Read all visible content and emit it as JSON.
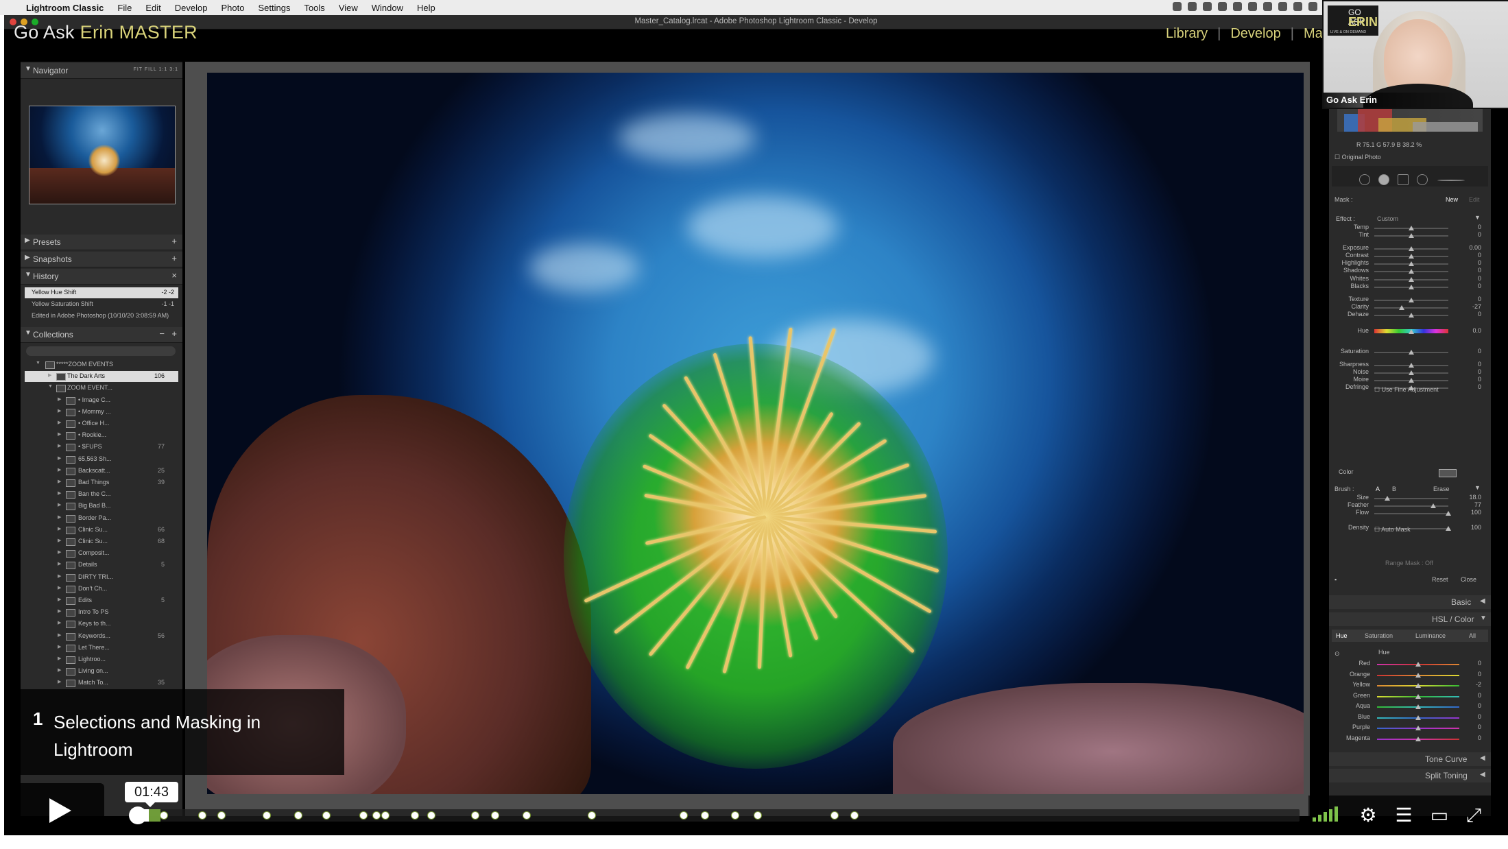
{
  "menubar": {
    "app": "Lightroom Classic",
    "items": [
      "File",
      "Edit",
      "Develop",
      "Photo",
      "Settings",
      "Tools",
      "View",
      "Window",
      "Help"
    ]
  },
  "window": {
    "title": "Master_Catalog.lrcat - Adobe Photoshop Lightroom Classic - Develop"
  },
  "identity_plate": {
    "part1": "Go Ask ",
    "part2": "Erin MASTER"
  },
  "modules": {
    "library": "Library",
    "develop": "Develop",
    "map": "Map"
  },
  "left": {
    "navigator": {
      "label": "Navigator",
      "zoom": "FIT  FILL  1:1  3:1"
    },
    "presets": "Presets",
    "snapshots": "Snapshots",
    "history": {
      "label": "History",
      "rows": [
        {
          "text": "Yellow Hue Shift",
          "a": "-2",
          "b": "-2"
        },
        {
          "text": "Yellow Saturation Shift",
          "a": "-1",
          "b": "-1"
        },
        {
          "text": "Edited in Adobe Photoshop (10/10/20 3:08:59 AM)",
          "a": "",
          "b": ""
        }
      ]
    },
    "collections": {
      "label": "Collections",
      "rows": [
        {
          "text": "*****ZOOM EVENTS",
          "n": ""
        },
        {
          "text": "The Dark Arts",
          "n": "106"
        },
        {
          "text": "ZOOM EVENT...",
          "n": ""
        },
        {
          "text": "• Image C...",
          "n": ""
        },
        {
          "text": "• Mommy ...",
          "n": ""
        },
        {
          "text": "• Office H...",
          "n": ""
        },
        {
          "text": "• Rookie...",
          "n": ""
        },
        {
          "text": "• $FUPS",
          "n": "77"
        },
        {
          "text": "65,563 Sh...",
          "n": ""
        },
        {
          "text": "Backscatt...",
          "n": "25"
        },
        {
          "text": "Bad Things",
          "n": "39"
        },
        {
          "text": "Ban the C...",
          "n": ""
        },
        {
          "text": "Big Bad B...",
          "n": ""
        },
        {
          "text": "Border Pa...",
          "n": ""
        },
        {
          "text": "Clinic Su...",
          "n": "66"
        },
        {
          "text": "Clinic Su...",
          "n": "68"
        },
        {
          "text": "Composit...",
          "n": ""
        },
        {
          "text": "Details",
          "n": "5"
        },
        {
          "text": "DIRTY TRI...",
          "n": ""
        },
        {
          "text": "Don't Ch...",
          "n": ""
        },
        {
          "text": "Edits",
          "n": "5"
        },
        {
          "text": "Intro To PS",
          "n": ""
        },
        {
          "text": "Keys to th...",
          "n": ""
        },
        {
          "text": "Keywords...",
          "n": "56"
        },
        {
          "text": "Let There...",
          "n": ""
        },
        {
          "text": "Lightroo...",
          "n": ""
        },
        {
          "text": "Living on...",
          "n": ""
        },
        {
          "text": "Match To...",
          "n": "35"
        }
      ]
    }
  },
  "right": {
    "readout": {
      "r_label": "R",
      "r": "75.1",
      "g_label": "G",
      "g": "57.9",
      "b_label": "B",
      "b": "38.2",
      "unit": "%"
    },
    "original_photo": "Original Photo",
    "mask": {
      "label": "Mask :",
      "new": "New",
      "edit": "Edit"
    },
    "effect": {
      "label": "Effect :",
      "value": "Custom"
    },
    "sliders": [
      {
        "label": "Temp",
        "value": "0"
      },
      {
        "label": "Tint",
        "value": "0"
      },
      {
        "label": "Exposure",
        "value": "0.00"
      },
      {
        "label": "Contrast",
        "value": "0"
      },
      {
        "label": "Highlights",
        "value": "0"
      },
      {
        "label": "Shadows",
        "value": "0"
      },
      {
        "label": "Whites",
        "value": "0"
      },
      {
        "label": "Blacks",
        "value": "0"
      },
      {
        "label": "Texture",
        "value": "0"
      },
      {
        "label": "Clarity",
        "value": "-27"
      },
      {
        "label": "Dehaze",
        "value": "0"
      },
      {
        "label": "Hue",
        "value": "0.0"
      },
      {
        "label": "Saturation",
        "value": "0"
      },
      {
        "label": "Sharpness",
        "value": "0"
      },
      {
        "label": "Noise",
        "value": "0"
      },
      {
        "label": "Moire",
        "value": "0"
      },
      {
        "label": "Defringe",
        "value": "0"
      }
    ],
    "fine_adjust": "Use Fine Adjustment",
    "color_label": "Color",
    "brush": {
      "label": "Brush :",
      "a": "A",
      "b": "B",
      "erase": "Erase"
    },
    "brush_sliders": [
      {
        "label": "Size",
        "value": "18.0"
      },
      {
        "label": "Feather",
        "value": "77"
      },
      {
        "label": "Flow",
        "value": "100"
      },
      {
        "label": "Density",
        "value": "100"
      }
    ],
    "auto_mask": "Auto Mask",
    "range_mask": "Range Mask : Off",
    "reset": "Reset",
    "close": "Close",
    "basic": "Basic",
    "hsl": "HSL / Color",
    "hsl_tabs": [
      "Hue",
      "Saturation",
      "Luminance",
      "All"
    ],
    "hsl_sub": "Hue",
    "hsl_rows": [
      {
        "label": "Red",
        "value": "0"
      },
      {
        "label": "Orange",
        "value": "0"
      },
      {
        "label": "Yellow",
        "value": "-2"
      },
      {
        "label": "Green",
        "value": "0"
      },
      {
        "label": "Aqua",
        "value": "0"
      },
      {
        "label": "Blue",
        "value": "0"
      },
      {
        "label": "Purple",
        "value": "0"
      },
      {
        "label": "Magenta",
        "value": "0"
      }
    ],
    "tone_curve": "Tone Curve",
    "split_toning": "Split Toning"
  },
  "webcam": {
    "logo_top": "GO ASK",
    "logo_main": "ERIN",
    "logo_sub": "LIVE & ON DEMAND",
    "name": "Go Ask Erin"
  },
  "video": {
    "chapter_number": "1",
    "chapter_title": "Selections and Masking in Lightroom",
    "time": "01:43",
    "progress": 0.013,
    "buffered": 0.023,
    "chapter_marks": [
      0.026,
      0.059,
      0.075,
      0.114,
      0.141,
      0.165,
      0.197,
      0.208,
      0.216,
      0.241,
      0.255,
      0.293,
      0.31,
      0.337,
      0.393,
      0.472,
      0.49,
      0.516,
      0.535,
      0.601,
      0.618
    ]
  }
}
